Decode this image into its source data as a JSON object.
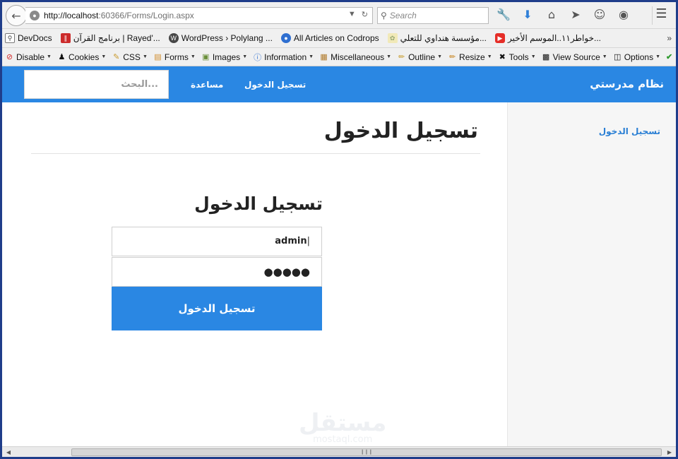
{
  "browser": {
    "url_host": "http://localhost",
    "url_rest": ":60366/Forms/Login.aspx",
    "search_placeholder": "Search",
    "bookmarks": [
      {
        "label": "DevDocs",
        "icon": "devdocs-icon",
        "color": "#555555"
      },
      {
        "label": "برنامج القرآن | Rayed'...",
        "icon": "quran-app-icon",
        "color": "#cc2b2b"
      },
      {
        "label": "WordPress › Polylang ...",
        "icon": "wordpress-icon",
        "color": "#464646"
      },
      {
        "label": "All Articles on Codrops",
        "icon": "codrops-icon",
        "color": "#2f6fd1"
      },
      {
        "label": "مؤسسة هنداوي للتعلي...",
        "icon": "hindawi-icon",
        "color": "#e8d36a"
      },
      {
        "label": "خواطر١١..الموسم الأخير...",
        "icon": "youtube-icon",
        "color": "#e52d27"
      }
    ],
    "webdev_items": [
      {
        "label": "Disable",
        "icon": "disable-icon",
        "color": "#d42a2a"
      },
      {
        "label": "Cookies",
        "icon": "cookies-icon",
        "color": "#333333"
      },
      {
        "label": "CSS",
        "icon": "css-icon",
        "color": "#c99a2e"
      },
      {
        "label": "Forms",
        "icon": "forms-icon",
        "color": "#d08b2a"
      },
      {
        "label": "Images",
        "icon": "images-icon",
        "color": "#6a8f3a"
      },
      {
        "label": "Information",
        "icon": "information-icon",
        "color": "#2f6fd1"
      },
      {
        "label": "Miscellaneous",
        "icon": "miscellaneous-icon",
        "color": "#b07a2a"
      },
      {
        "label": "Outline",
        "icon": "outline-icon",
        "color": "#c9a23a"
      },
      {
        "label": "Resize",
        "icon": "resize-icon",
        "color": "#c98a2a"
      },
      {
        "label": "Tools",
        "icon": "tools-icon",
        "color": "#555555"
      },
      {
        "label": "View Source",
        "icon": "view-source-icon",
        "color": "#333333"
      },
      {
        "label": "Options",
        "icon": "options-icon",
        "color": "#555555"
      }
    ]
  },
  "site": {
    "brand": "نظام مدرستي",
    "nav_login": "تسجيل الدخول",
    "nav_help": "مساعدة",
    "search_placeholder": "البحث...",
    "sidebar_link": "تسجيل الدخول",
    "page_title": "تسجيل الدخول",
    "form_title": "تسجيل الدخول",
    "username_value": "admin",
    "password_mask": "●●●●●",
    "submit_label": "تسجيل الدخول",
    "accent_color": "#2a87e3"
  },
  "watermark": {
    "logo": "مستقل",
    "text": "mostaql.com"
  }
}
